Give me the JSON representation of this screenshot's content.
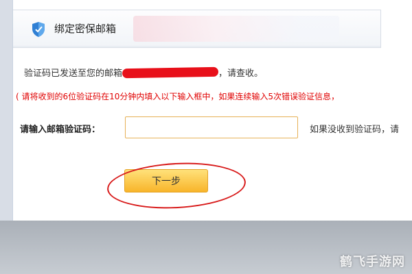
{
  "header": {
    "title": "绑定密保邮箱",
    "icon": "shield-icon"
  },
  "message": {
    "prefix": "验证码已发送至您的邮箱",
    "suffix": "，请查收。"
  },
  "warning": "( 请将收到的6位验证码在10分钟内填入以下输入框中，如果连续输入5次错误验证信息，",
  "form": {
    "label": "请输入邮箱验证码：",
    "value": "",
    "hint": "如果没收到验证码，请"
  },
  "next_button": "下一步",
  "watermark": "鹤飞手游网",
  "colors": {
    "warning": "#e00000",
    "button_top": "#ffe17a",
    "button_bottom": "#f8b52a",
    "annotation": "#d81a1a"
  }
}
